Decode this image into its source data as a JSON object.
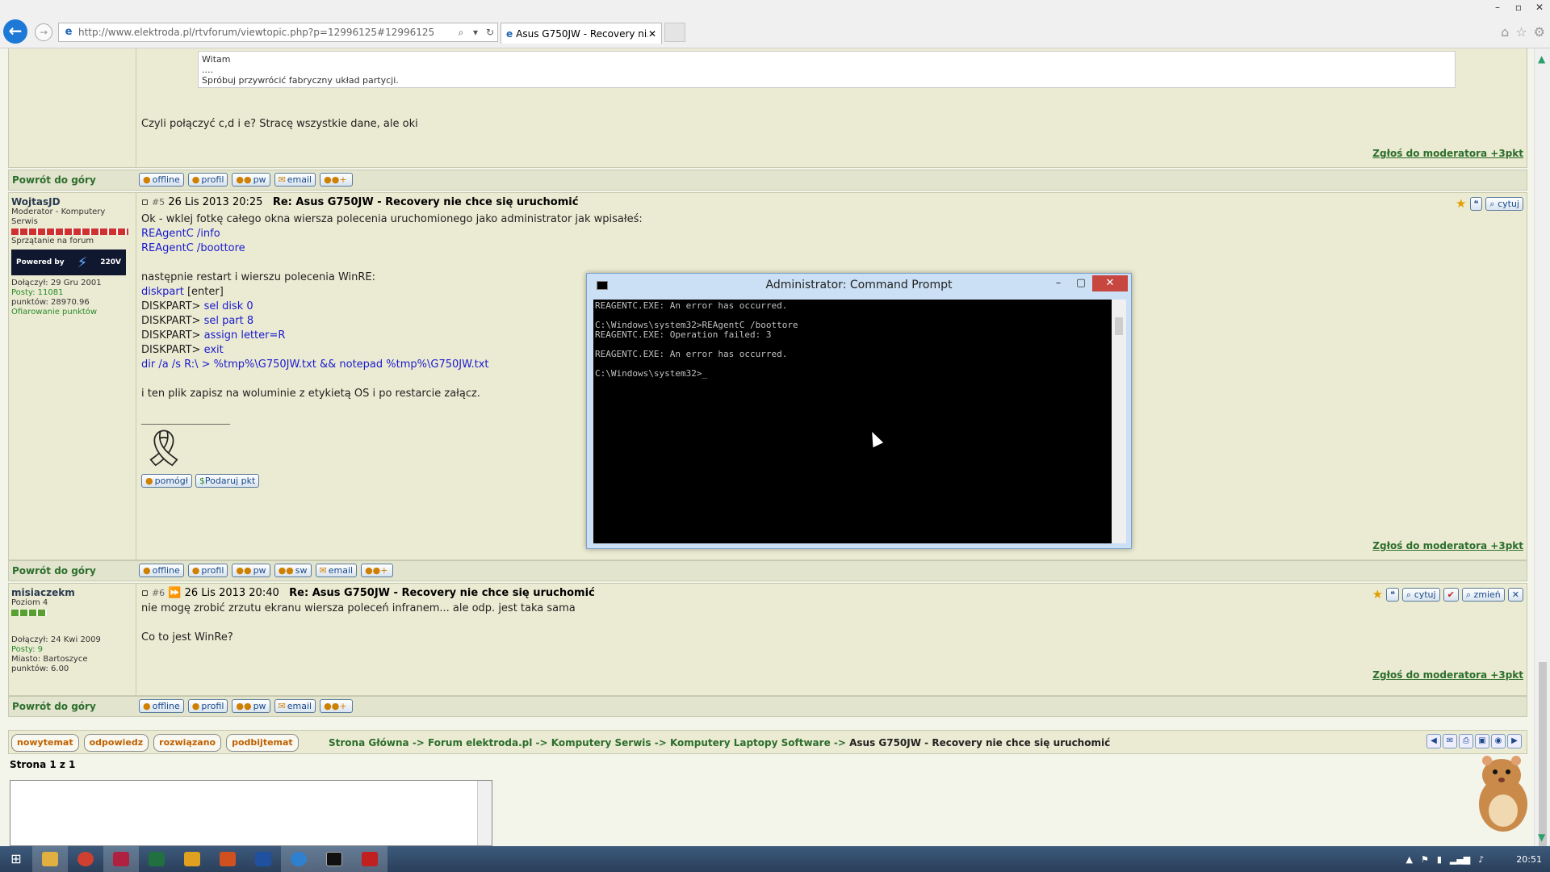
{
  "browser": {
    "url": "http://www.elektroda.pl/rtvforum/viewtopic.php?p=12996125#12996125",
    "tab_title": "Asus G750JW - Recovery ni...",
    "win_min": "–",
    "win_max": "▫",
    "win_close": "✕"
  },
  "quote": {
    "line1": "Witam",
    "line2": "....",
    "line3": "Spróbuj przywrócić fabryczny układ partycji."
  },
  "post4": {
    "text": "Czyli połączyć c,d i e? Stracę wszystkie dane, ale oki",
    "report": "Zgłoś do moderatora +3pkt"
  },
  "rowbar": {
    "top_label": "Powrót do góry",
    "offline": "offline",
    "profil": "profil",
    "pw": "pw",
    "sw": "sw",
    "email": "email"
  },
  "post5": {
    "author": "WojtasJD",
    "rank": "Moderator - Komputery Serwis",
    "tag": "Sprzątanie na forum",
    "powered": "Powered by",
    "volts": "220V",
    "joined": "Dołączył: 29 Gru 2001",
    "posts": "Posty: 11081",
    "points": "punktów: 28970.96",
    "donate": "Ofiarowanie punktów",
    "num": "#5",
    "date": "26 Lis 2013 20:25",
    "subject": "Re: Asus G750JW - Recovery nie chce się uruchomić",
    "cytuj": "cytuj",
    "l1": "Ok - wklej fotkę całego okna wiersza polecenia uruchomionego jako administrator jak wpisałeś:",
    "l2": "REAgentC /info",
    "l3": "REAgentC /boottore",
    "l4": "następnie restart i wierszu polecenia WinRE:",
    "l5a": "diskpart",
    "l5b": " [enter]",
    "l6a": "DISKPART> ",
    "l6b": "sel disk 0",
    "l7b": "sel part 8",
    "l8b": "assign letter=R",
    "l9b": "exit",
    "l10": "dir /a /s R:\\ > %tmp%\\G750JW.txt && notepad %tmp%\\G750JW.txt",
    "l11": "i ten plik zapisz na woluminie z etykietą OS i po restarcie załącz.",
    "sig_sep": "____________________",
    "pomogl": "pomógł",
    "podaruj": "Podaruj pkt",
    "report": "Zgłoś do moderatora +3pkt"
  },
  "post6": {
    "author": "misiaczekm",
    "rank": "Poziom 4",
    "joined": "Dołączył: 24 Kwi 2009",
    "posts": "Posty: 9",
    "city": "Miasto: Bartoszyce",
    "points": "punktów: 6.00",
    "num": "#6",
    "date": "26 Lis 2013 20:40",
    "subject": "Re: Asus G750JW - Recovery nie chce się uruchomić",
    "cytuj": "cytuj",
    "zmien": "zmień",
    "l1": "nie mogę zrobić zrzutu ekranu wiersza poleceń infranem... ale odp. jest taka sama",
    "l2": "Co to jest WinRe?",
    "report": "Zgłoś do moderatora +3pkt"
  },
  "cmd": {
    "title": "Administrator: Command Prompt",
    "console": "REAGENTC.EXE: An error has occurred.\n\nC:\\Windows\\system32>REAgentC /boottore\nREAGENTC.EXE: Operation failed: 3\n\nREAGENTC.EXE: An error has occurred.\n\nC:\\Windows\\system32>_"
  },
  "nav": {
    "nowy": "nowytemat",
    "odpowiedz": "odpowiedz",
    "rozwiazano": "rozwiązano",
    "podbij": "podbijtemat",
    "c1": "Strona Główna",
    "c2": "Forum elektroda.pl",
    "c3": "Komputery Serwis",
    "c4": "Komputery Laptopy Software",
    "c5": "Asus G750JW - Recovery nie chce się uruchomić",
    "sep": " -> ",
    "pages": "Strona 1 z 1"
  },
  "taskbar": {
    "clock": "20:51"
  },
  "colors": {
    "page_bg": "#f3f4ea",
    "post_bg": "#ebebd3",
    "link_green": "#2c6e2c",
    "console_bg": "#000000",
    "close_red": "#c7463f"
  }
}
